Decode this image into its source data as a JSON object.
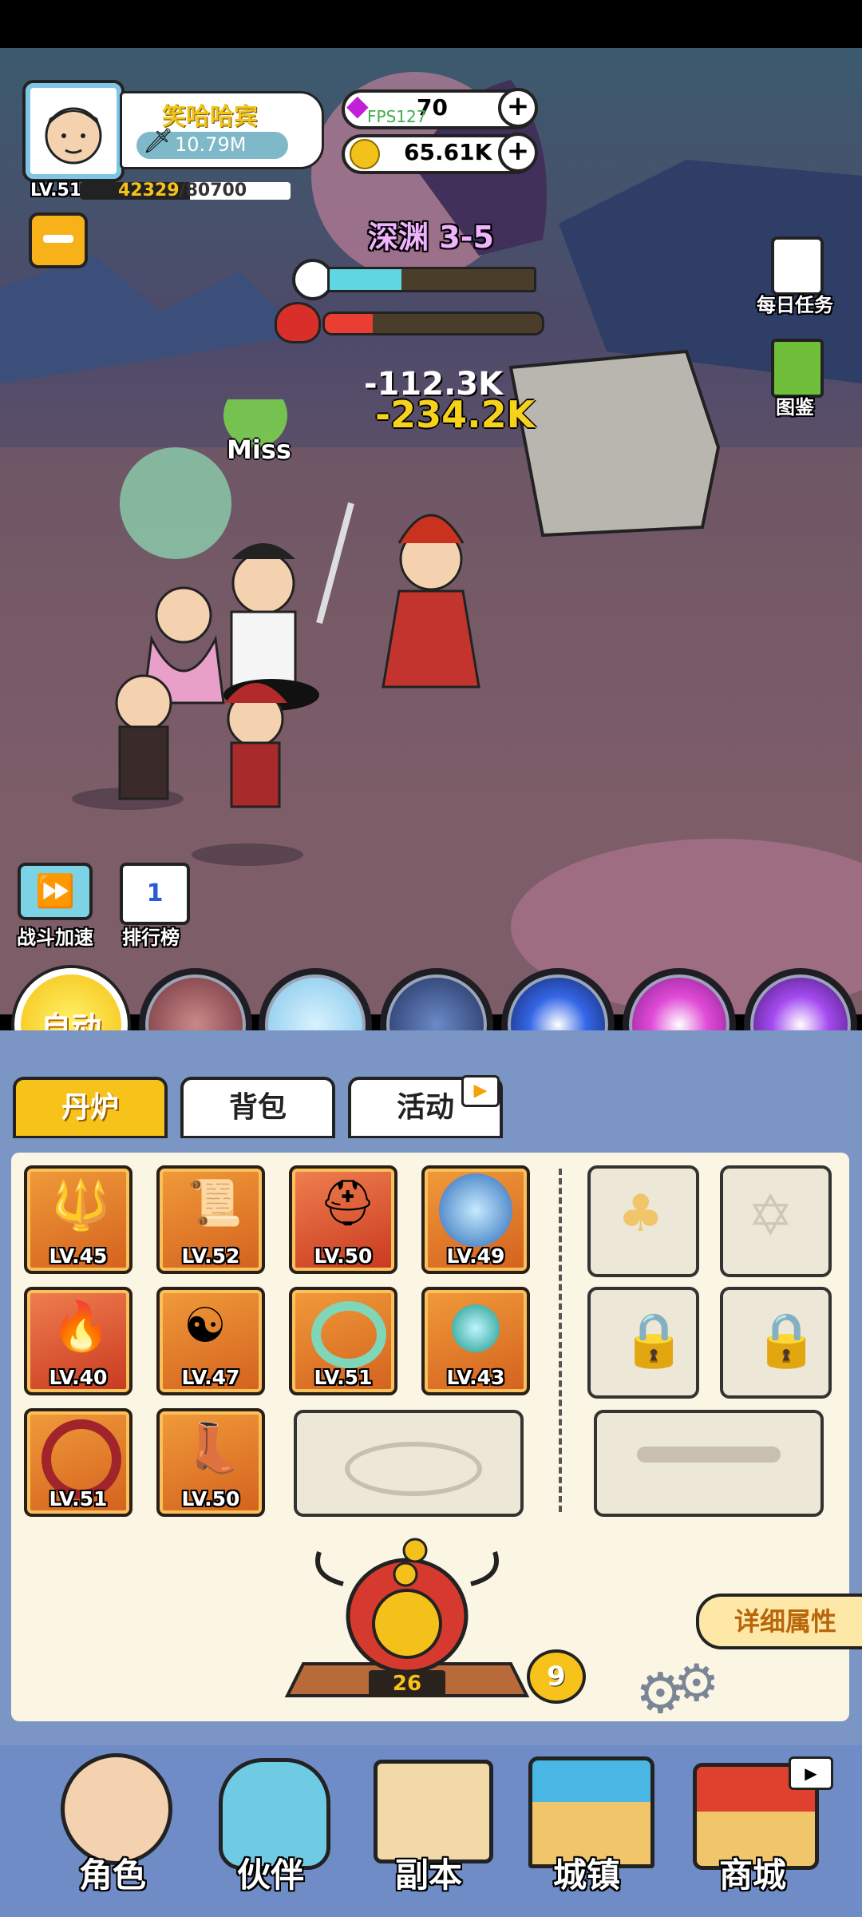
{
  "player": {
    "name": "笑哈哈宾",
    "power": "10.79M",
    "level": "LV.51",
    "exp_current": "42329",
    "exp_total": "/80700",
    "exp_progress": 0.5245
  },
  "currency": {
    "gems": "70",
    "coins": "65.61K"
  },
  "fps": "FPS127",
  "stage": {
    "title": "深渊 3-5",
    "timer_progress": 0.35,
    "boss_hp_progress": 0.22
  },
  "side_buttons": {
    "daily_tasks": "每日任务",
    "codex": "图鉴"
  },
  "combat_text": {
    "damage_1": "-112.3K",
    "damage_2": "-234.2K",
    "miss": "Miss"
  },
  "battle_controls": {
    "speed_label": "战斗加速",
    "rank_label": "排行榜",
    "auto_label": "自动"
  },
  "tabs": [
    "丹炉",
    "背包",
    "活动"
  ],
  "equipment": [
    {
      "icon": "spear-icon",
      "level": "LV.45"
    },
    {
      "icon": "scroll-icon",
      "level": "LV.52"
    },
    {
      "icon": "helmet-icon",
      "level": "LV.50"
    },
    {
      "icon": "orb-bird-icon",
      "level": "LV.49"
    },
    {
      "icon": "flame-icon",
      "level": "LV.40"
    },
    {
      "icon": "bagua-icon",
      "level": "LV.47"
    },
    {
      "icon": "jade-ring-icon",
      "level": "LV.51"
    },
    {
      "icon": "wave-orb-icon",
      "level": "LV.43"
    },
    {
      "icon": "belt-icon",
      "level": "LV.51"
    },
    {
      "icon": "boots-icon",
      "level": "LV.50"
    }
  ],
  "furnace": {
    "count": "26",
    "badge": "9",
    "detail_label": "详细属性"
  },
  "nav": [
    "角色",
    "伙伴",
    "副本",
    "城镇",
    "商城"
  ],
  "colors": {
    "gold": "#f7c21a",
    "panel_blue": "#7b95c4",
    "cream": "#fbf6e4",
    "slot_orange": "#e47a2a"
  }
}
